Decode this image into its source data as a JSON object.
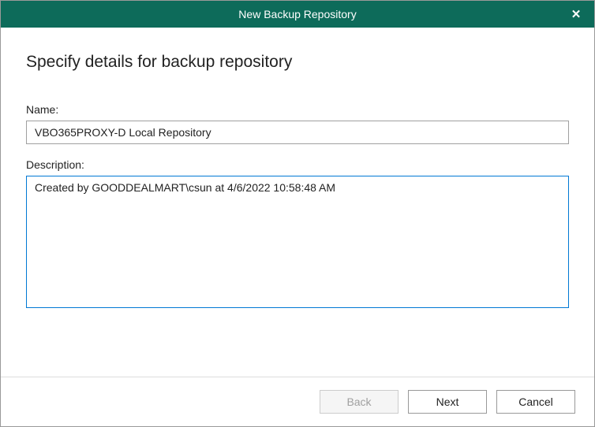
{
  "titlebar": {
    "title": "New Backup Repository"
  },
  "content": {
    "heading": "Specify details for backup repository",
    "name_label": "Name:",
    "name_value": "VBO365PROXY-D Local Repository",
    "description_label": "Description:",
    "description_value": "Created by GOODDEALMART\\csun at 4/6/2022 10:58:48 AM"
  },
  "footer": {
    "back_label": "Back",
    "next_label": "Next",
    "cancel_label": "Cancel"
  }
}
